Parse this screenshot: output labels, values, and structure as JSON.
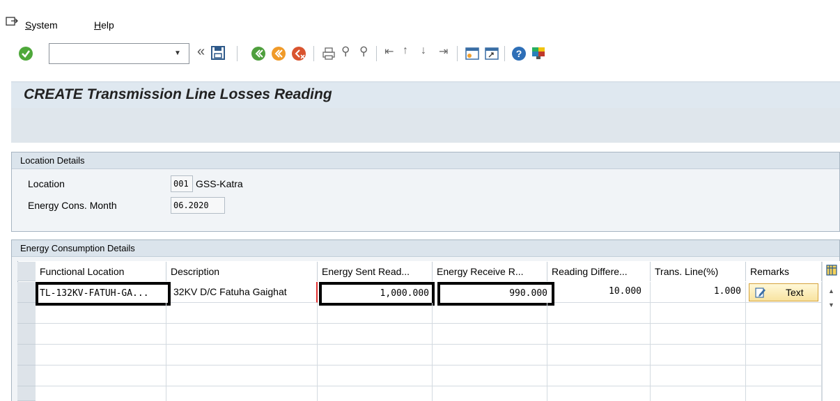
{
  "menu": {
    "items": [
      {
        "first": "S",
        "rest": "ystem"
      },
      {
        "first": "H",
        "rest": "elp"
      }
    ]
  },
  "toolbar": {
    "command_value": "",
    "icons": [
      "enter-icon",
      "back-icon",
      "save-icon",
      "green-back-icon",
      "exit-icon",
      "cancel-icon",
      "print-icon",
      "find-icon",
      "find-next-icon",
      "first-page-icon",
      "previous-page-icon",
      "next-page-icon",
      "last-page-icon",
      "new-session-icon",
      "shortcut-icon",
      "help-icon",
      "customize-layout-icon"
    ]
  },
  "page": {
    "title": "CREATE Transmission Line Losses Reading"
  },
  "location_details": {
    "heading": "Location Details",
    "location_label": "Location",
    "location_code": "001",
    "location_name": "GSS-Katra",
    "month_label": "Energy Cons. Month",
    "month_value": "06.2020"
  },
  "energy_details": {
    "heading": "Energy Consumption Details",
    "columns": [
      "Functional Location",
      "Description",
      "Energy Sent Read...",
      "Energy Receive R...",
      "Reading Differe...",
      "Trans. Line(%)",
      "Remarks"
    ],
    "rows": [
      {
        "functional_location": "TL-132KV-FATUH-GA...",
        "description": "32KV D/C Fatuha Gaighat",
        "energy_sent": "1,000.000",
        "energy_received": "990.000",
        "reading_difference": "10.000",
        "trans_line_pct": "1.000",
        "remarks": "Text"
      }
    ]
  },
  "colors": {
    "title_bg": "#dfe8f0",
    "group_header": "#dbe4ec",
    "highlight_border": "#000000",
    "required_marker": "#e03030"
  }
}
